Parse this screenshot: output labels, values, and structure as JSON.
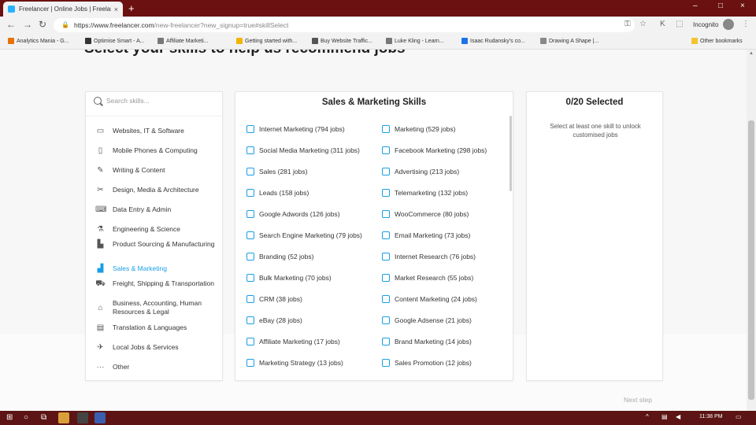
{
  "browser": {
    "tab_title": "Freelancer | Online Jobs | Freelan",
    "tab_close": "×",
    "new_tab": "+",
    "url_host": "https://www.freelancer.com",
    "url_path": "/new-freelancer?new_signup=true#skillSelect",
    "profile_label": "Incognito",
    "window_minimize": "–",
    "window_maximize": "□",
    "window_close": "×"
  },
  "bookmarks": [
    {
      "label": "Analytics Mania - G...",
      "color": "#e8710a"
    },
    {
      "label": "Optimise Smart - A...",
      "color": "#333333"
    },
    {
      "label": "Affiliate Marketi...",
      "color": "#777777"
    },
    {
      "label": "Getting started with...",
      "color": "#f4b400"
    },
    {
      "label": "Buy Website Traffic...",
      "color": "#555555"
    },
    {
      "label": "Luke Kling - Learn...",
      "color": "#777777"
    },
    {
      "label": "Isaac Rudansky's co...",
      "color": "#1a73e8"
    },
    {
      "label": "Drawing A Shape |...",
      "color": "#888888"
    },
    {
      "label": "Other bookmarks",
      "color": "#f4c430"
    }
  ],
  "page": {
    "heading": "Select your skills to help us recommend jobs",
    "search_placeholder": "Search skills..."
  },
  "categories": [
    {
      "label": "Websites, IT & Software",
      "icon": "monitor-icon",
      "glyph": "▭",
      "active": false
    },
    {
      "label": "Mobile Phones & Computing",
      "icon": "mobile-icon",
      "glyph": "▯",
      "active": false
    },
    {
      "label": "Writing & Content",
      "icon": "pen-icon",
      "glyph": "✎",
      "active": false
    },
    {
      "label": "Design, Media & Architecture",
      "icon": "design-tools-icon",
      "glyph": "✂",
      "active": false
    },
    {
      "label": "Data Entry & Admin",
      "icon": "keyboard-icon",
      "glyph": "⌨",
      "active": false
    },
    {
      "label": "Engineering & Science",
      "icon": "flask-icon",
      "glyph": "⚗",
      "active": false
    },
    {
      "label": "Product Sourcing & Manufacturing",
      "icon": "factory-icon",
      "glyph": "▙",
      "active": false
    },
    {
      "label": "Sales & Marketing",
      "icon": "bar-chart-icon",
      "glyph": "▟",
      "active": true
    },
    {
      "label": "Freight, Shipping & Transportation",
      "icon": "truck-icon",
      "glyph": "⛟",
      "active": false
    },
    {
      "label": "Business, Accounting, Human Resources & Legal",
      "icon": "bank-icon",
      "glyph": "⌂",
      "active": false
    },
    {
      "label": "Translation & Languages",
      "icon": "translate-icon",
      "glyph": "▤",
      "active": false
    },
    {
      "label": "Local Jobs & Services",
      "icon": "wrench-icon",
      "glyph": "✈",
      "active": false
    },
    {
      "label": "Other",
      "icon": "more-icon",
      "glyph": "···",
      "active": false
    }
  ],
  "skills_panel": {
    "title": "Sales & Marketing Skills",
    "skills": [
      "Internet Marketing (794 jobs)",
      "Marketing (529 jobs)",
      "Social Media Marketing (311 jobs)",
      "Facebook Marketing (298 jobs)",
      "Sales (281 jobs)",
      "Advertising (213 jobs)",
      "Leads (158 jobs)",
      "Telemarketing (132 jobs)",
      "Google Adwords (126 jobs)",
      "WooCommerce (80 jobs)",
      "Search Engine Marketing (79 jobs)",
      "Email Marketing (73 jobs)",
      "Branding (52 jobs)",
      "Internet Research (76 jobs)",
      "Bulk Marketing (70 jobs)",
      "Market Research (55 jobs)",
      "CRM (38 jobs)",
      "Content Marketing (24 jobs)",
      "eBay (28 jobs)",
      "Google Adsense (21 jobs)",
      "Affiliate Marketing (17 jobs)",
      "Brand Marketing (14 jobs)",
      "Marketing Strategy (13 jobs)",
      "Sales Promotion (12 jobs)"
    ]
  },
  "selected_panel": {
    "title": "0/20 Selected",
    "note": "Select at least one skill to unlock customised jobs"
  },
  "next_step_label": "Next step",
  "taskbar": {
    "clock": "11:38 PM"
  }
}
